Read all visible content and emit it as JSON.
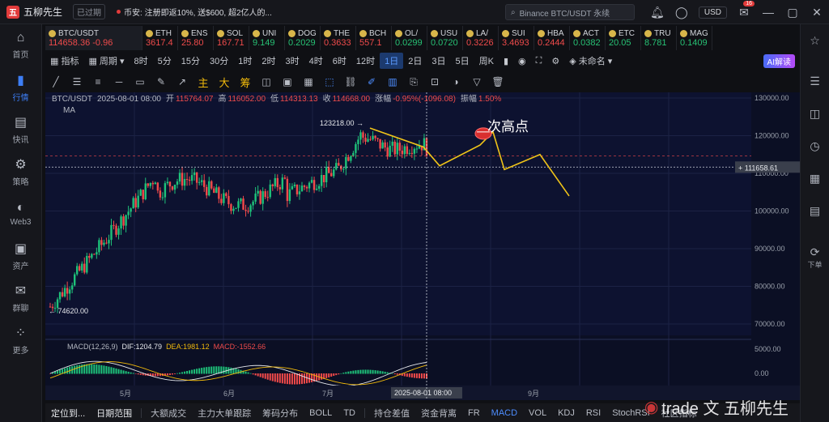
{
  "app": {
    "logo": "五",
    "title": "五柳先生",
    "expired": "已过期"
  },
  "news": {
    "text": "币安: 注册即返10%, 送$600, 超2亿人的..."
  },
  "search": {
    "placeholder": "Binance BTC/USDT 永续"
  },
  "currency": "USD",
  "mail_badge": "16",
  "left_nav": [
    {
      "label": "首页",
      "icon": "⌂"
    },
    {
      "label": "行情",
      "icon": "▮"
    },
    {
      "label": "快讯",
      "icon": "▤"
    },
    {
      "label": "策略",
      "icon": "⚙"
    },
    {
      "label": "Web3",
      "icon": "◐"
    },
    {
      "label": "资产",
      "icon": "▣"
    },
    {
      "label": "群聊",
      "icon": "✉"
    },
    {
      "label": "更多",
      "icon": "⁘"
    }
  ],
  "right_nav": {
    "bottom_label": "下单"
  },
  "tickers": [
    {
      "sym": "BTC/USDT",
      "price": "114658.36",
      "change": "-0.96",
      "up": false
    },
    {
      "sym": "ETH",
      "price": "3617.4",
      "up": false
    },
    {
      "sym": "ENS",
      "price": "25.80",
      "up": false
    },
    {
      "sym": "SOL",
      "price": "167.71",
      "up": false
    },
    {
      "sym": "UNI",
      "price": "9.149",
      "up": true
    },
    {
      "sym": "DOG",
      "price": "0.2029",
      "up": true
    },
    {
      "sym": "THE",
      "price": "0.3633",
      "up": false
    },
    {
      "sym": "BCH",
      "price": "557.1",
      "up": false
    },
    {
      "sym": "OL/",
      "price": "0.0299",
      "up": true
    },
    {
      "sym": "USU",
      "price": "0.0720",
      "up": true
    },
    {
      "sym": "LA/",
      "price": "0.3226",
      "up": false
    },
    {
      "sym": "SUI",
      "price": "3.4693",
      "up": false
    },
    {
      "sym": "HBA",
      "price": "0.2444",
      "up": false
    },
    {
      "sym": "ACT",
      "price": "0.0382",
      "up": true
    },
    {
      "sym": "ETC",
      "price": "20.05",
      "up": true
    },
    {
      "sym": "TRU",
      "price": "8.781",
      "up": true
    },
    {
      "sym": "MAG",
      "price": "0.1409",
      "up": true
    }
  ],
  "toolbar": {
    "indicator": "指标",
    "period": "周期",
    "intervals": [
      "8时",
      "5分",
      "15分",
      "30分",
      "1时",
      "2时",
      "3时",
      "4时",
      "6时",
      "12时",
      "1日",
      "2日",
      "3日",
      "5日",
      "周K"
    ],
    "selected": "1日",
    "unnamed": "未命名",
    "ai": "AI解读"
  },
  "chart_info": {
    "pair": "BTC/USDT",
    "date": "2025-08-01 08:00",
    "open_label": "开",
    "open": "115764.07",
    "high_label": "高",
    "high": "116052.00",
    "low_label": "低",
    "low": "114313.13",
    "close_label": "收",
    "close": "114668.00",
    "chg_label": "涨幅",
    "chg": "-0.95%(-1096.08)",
    "amp_label": "振幅",
    "amp": "1.50%",
    "ma_label": "MA",
    "high_mark": "123218.00 →",
    "low_mark": "← 74620.00",
    "price_tag": "111658.61",
    "annotation": "次高点",
    "macd_label": "MACD(12,26,9)",
    "dif": "DIF:1204.79",
    "dea": "DEA:1981.12",
    "macd": "MACD:-1552.66",
    "x_cursor": "2025-08-01 08:00"
  },
  "chart_data": {
    "type": "candlestick",
    "y_ticks": [
      "130000.00",
      "120000.00",
      "110000.00",
      "100000.00",
      "90000.00",
      "80000.00",
      "70000.00"
    ],
    "ylim": [
      67000,
      131500
    ],
    "x_ticks": [
      "5月",
      "6月",
      "7月",
      "9月"
    ],
    "macd_ticks": [
      "5000.00",
      "0.00"
    ],
    "start_price": 74620,
    "peak": 123218,
    "last_close": 114668,
    "projection": [
      112000,
      117500,
      121000,
      111000,
      115000,
      104000
    ]
  },
  "bottom": {
    "items": [
      "定位到...",
      "日期范围",
      "大额成交",
      "主力大单跟踪",
      "筹码分布",
      "BOLL",
      "TD",
      "持仓差值",
      "资金背离",
      "FR",
      "MACD",
      "VOL",
      "KDJ",
      "RSI",
      "StochRSI",
      "社区指标"
    ],
    "selected": "MACD"
  },
  "watermark": "trade 文 五柳先生"
}
